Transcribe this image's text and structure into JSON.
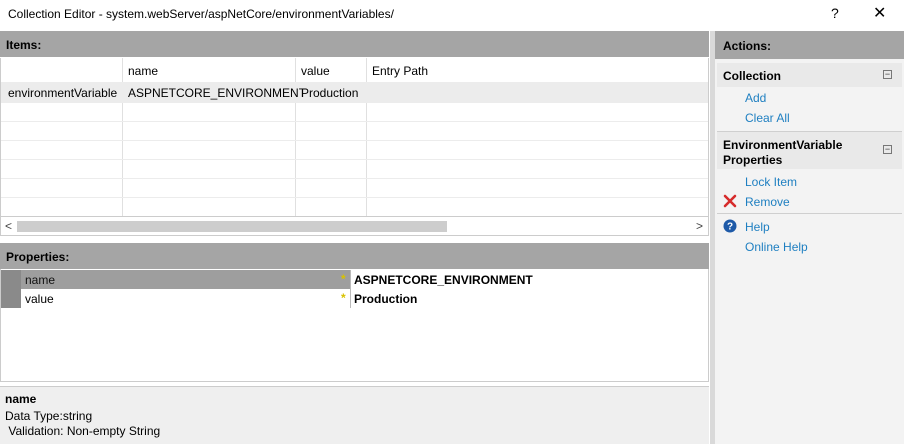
{
  "window": {
    "title": "Collection Editor - system.webServer/aspNetCore/environmentVariables/",
    "help_glyph": "?",
    "close_glyph": "✕"
  },
  "items": {
    "header": "Items:",
    "columns": [
      "",
      "name",
      "value",
      "Entry Path"
    ],
    "rows": [
      {
        "type": "environmentVariable",
        "name": "ASPNETCORE_ENVIRONMENT",
        "value": "Production",
        "entry_path": ""
      }
    ]
  },
  "scrollbar": {
    "left_arrow": "<",
    "right_arrow": ">"
  },
  "properties": {
    "header": "Properties:",
    "rows": [
      {
        "name": "name",
        "value": "ASPNETCORE_ENVIRONMENT",
        "required": "*"
      },
      {
        "name": "value",
        "value": "Production",
        "required": "*"
      }
    ]
  },
  "description": {
    "name": "name",
    "line1": "Data Type:string",
    "line2": " Validation: Non-empty String"
  },
  "actions": {
    "header": "Actions:",
    "collection": {
      "title": "Collection",
      "add": "Add",
      "clear_all": "Clear All"
    },
    "env_props": {
      "title": "EnvironmentVariable Properties",
      "lock_item": "Lock Item",
      "remove": "Remove"
    },
    "help": "Help",
    "online_help": "Online Help",
    "collapse_glyph": "−",
    "remove_icon_color": "#d62b2b",
    "help_icon_color": "#1e5aa8"
  }
}
